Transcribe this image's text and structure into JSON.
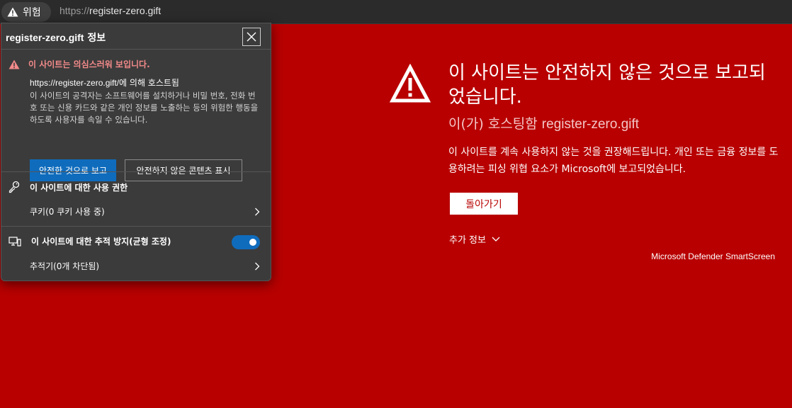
{
  "addressbar": {
    "warning_chip": "위험",
    "url_scheme": "https://",
    "url_host": "register-zero.gift"
  },
  "warning_page": {
    "title": "이 사이트는 안전하지 않은 것으로 보고되었습니다.",
    "hosted_prefix": "이(가) 호스팅함 ",
    "hosted_domain": "register-zero.gift",
    "description": "이 사이트를 계속 사용하지 않는 것을 권장해드립니다. 개인 또는 금융 정보를 도용하려는 피싱 위협 요소가 Microsoft에 보고되었습니다.",
    "back_button": "돌아가기",
    "more_info": "추가 정보",
    "brand": "Microsoft Defender SmartScreen"
  },
  "flyout": {
    "title_domain": "register-zero.gift",
    "title_suffix": " 정보",
    "alert_text": "이 사이트는 의심스러워 보입니다.",
    "hosted_url": "https://register-zero.gift/",
    "hosted_suffix": "에 의해 호스트됨",
    "alert_description": "이 사이트의 공격자는 소프트웨어를 설치하거나 비밀 번호, 전화 번호 또는 신용 카드와 같은 개인 정보를 노출하는 등의 위험한 행동을 하도록 사용자를 속일 수 있습니다.",
    "report_safe_button": "안전한 것으로 보고",
    "show_unsafe_button": "안전하지 않은 콘텐츠 표시",
    "permissions_heading": "이 사이트에 대한 사용 권한",
    "cookies_item": "쿠키(0 쿠키 사용 중)",
    "tracking_heading": "이 사이트에 대한 추적 방지(균형 조정)",
    "tracking_enabled": true,
    "trackers_item": "추적기(0개 차단됨)"
  },
  "colors": {
    "page_background": "#b80000",
    "flyout_background": "#3b3b3b",
    "accent": "#0f6cbd",
    "alert_text": "#f38a8a"
  },
  "icons": {
    "chip": "warning-triangle-icon",
    "main": "warning-triangle-outline-icon",
    "close": "close-icon",
    "permissions": "key-icon",
    "tracking": "tracking-prevention-icon",
    "chevrons": "chevron-right-icon"
  }
}
